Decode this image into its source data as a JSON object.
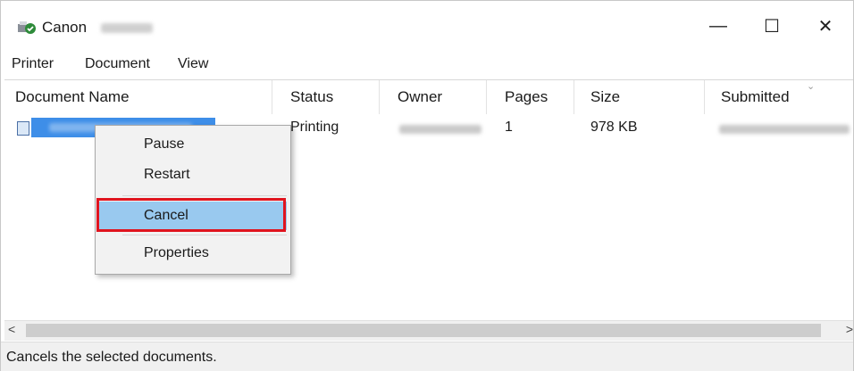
{
  "window": {
    "title": "Canon",
    "controls": {
      "minimize": "—",
      "maximize": "☐",
      "close": "✕"
    }
  },
  "menu": [
    "Printer",
    "Document",
    "View"
  ],
  "columns": [
    "Document Name",
    "Status",
    "Owner",
    "Pages",
    "Size",
    "Submitted"
  ],
  "rows": [
    {
      "status": "Printing",
      "pages": "1",
      "size": "978 KB"
    }
  ],
  "context_menu": {
    "items": [
      "Pause",
      "Restart",
      "Cancel",
      "Properties"
    ],
    "highlighted": "Cancel",
    "highlight_color": "#99c9ef",
    "callout_color": "#e0141e"
  },
  "scrollbar": {
    "left_arrow": "<",
    "right_arrow": ">"
  },
  "statusbar": {
    "text": "Cancels the selected documents."
  },
  "icons": {
    "app": "printer-icon",
    "document": "document-icon"
  }
}
